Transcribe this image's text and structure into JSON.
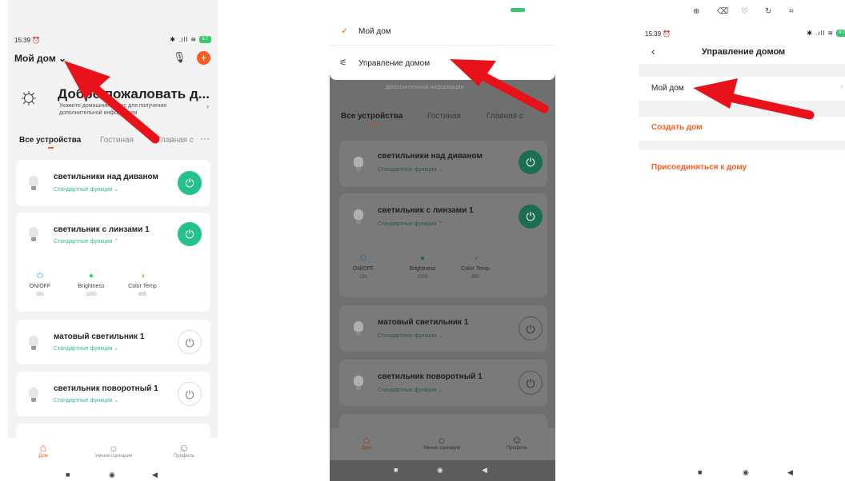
{
  "colors": {
    "accent": "#ff5a1f",
    "green": "#24c28a",
    "arrow": "#e8131a"
  },
  "p1": {
    "status": {
      "time": "15:39 ⏰",
      "right": "✱ .ıll ≋",
      "battery": "97"
    },
    "home_title": "Мой дом",
    "welcome_title": "Добро пожаловать д...",
    "welcome_sub": "Укажите домашний адрес для получения дополнительной информации",
    "rooms": {
      "all": "Все устройства",
      "living": "Гостиная",
      "main": "Главная с"
    },
    "devices": [
      {
        "name": "светильники над диваном",
        "sub": "Стандартные функции ⌄"
      },
      {
        "name": "светильник с линзами 1",
        "sub": "Стандартные функции ⌃"
      },
      {
        "name": "матовый светильник 1",
        "sub": "Стандартные функции ⌄"
      },
      {
        "name": "светильник поворотный 1",
        "sub": "Стандартные функции ⌄"
      }
    ],
    "controls": [
      {
        "label": "ON/OFF",
        "value": "ON"
      },
      {
        "label": "Brightness",
        "value": "1000"
      },
      {
        "label": "Color Temp",
        "value": "895"
      }
    ],
    "tabs": {
      "home": "Дом",
      "scenes": "Умные сценарии",
      "profile": "Профиль"
    }
  },
  "p2": {
    "menu": {
      "home": "Мой дом",
      "manage": "Управление домом"
    },
    "welcome_sub": "дополнительной информации",
    "rooms": {
      "all": "Все устройства",
      "living": "Гостиная",
      "main": "Главная с"
    },
    "devices": [
      {
        "name": "светильники над диваном",
        "sub": "Стандартные функции ⌄"
      },
      {
        "name": "светильник с линзами 1",
        "sub": "Стандартные функции ⌃"
      },
      {
        "name": "матовый светильник 1",
        "sub": "Стандартные функции ⌄"
      },
      {
        "name": "светильник поворотный 1",
        "sub": "Стандартные функции ⌄"
      }
    ],
    "controls": [
      {
        "label": "ON/OFF",
        "value": "ON"
      },
      {
        "label": "Brightness",
        "value": "1000"
      },
      {
        "label": "Color Temp",
        "value": "895"
      }
    ],
    "tabs": {
      "home": "Дом",
      "scenes": "Умные сценарии",
      "profile": "Профиль"
    }
  },
  "p3": {
    "status": {
      "time": "15:39 ⏰",
      "right": "✱ .ıll ≋",
      "battery": "97"
    },
    "title": "Управление домом",
    "my_home": "Мой дом",
    "create": "Создать дом",
    "join": "Присоединяться к дому"
  }
}
